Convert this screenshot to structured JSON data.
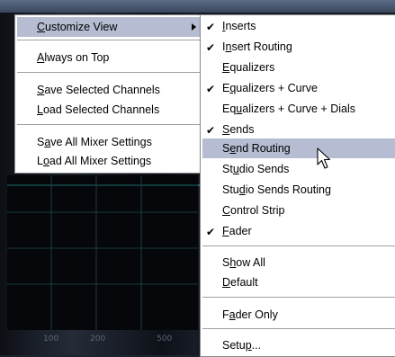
{
  "axis": {
    "labels": [
      "100",
      "200",
      "500"
    ]
  },
  "main_menu": {
    "items": [
      {
        "pre": "",
        "key": "C",
        "post": "ustomize View",
        "submenu": true,
        "highlighted": true
      },
      {
        "pre": "",
        "key": "A",
        "post": "lways on Top"
      },
      {
        "pre": "",
        "key": "S",
        "post": "ave Selected Channels"
      },
      {
        "pre": "",
        "key": "L",
        "post": "oad Selected Channels"
      },
      {
        "pre": "S",
        "key": "a",
        "post": "ve All Mixer Settings"
      },
      {
        "pre": "L",
        "key": "o",
        "post": "ad All Mixer Settings"
      }
    ]
  },
  "sub_menu": {
    "items": [
      {
        "pre": "",
        "key": "I",
        "post": "nserts",
        "checked": true
      },
      {
        "pre": "I",
        "key": "n",
        "post": "sert Routing",
        "checked": true
      },
      {
        "pre": "",
        "key": "E",
        "post": "qualizers",
        "checked": false
      },
      {
        "pre": "E",
        "key": "q",
        "post": "ualizers + Curve",
        "checked": true
      },
      {
        "pre": "Eq",
        "key": "u",
        "post": "alizers + Curve + Dials",
        "checked": false
      },
      {
        "pre": "",
        "key": "S",
        "post": "ends",
        "checked": true
      },
      {
        "pre": "S",
        "key": "e",
        "post": "nd Routing",
        "checked": false,
        "highlighted": true
      },
      {
        "pre": "St",
        "key": "u",
        "post": "dio Sends",
        "checked": false
      },
      {
        "pre": "Stu",
        "key": "d",
        "post": "io Sends Routing",
        "checked": false
      },
      {
        "pre": "",
        "key": "C",
        "post": "ontrol Strip",
        "checked": false
      },
      {
        "pre": "",
        "key": "F",
        "post": "ader",
        "checked": true
      },
      {
        "pre": "S",
        "key": "h",
        "post": "ow All",
        "checked": false
      },
      {
        "pre": "",
        "key": "D",
        "post": "efault",
        "checked": false
      },
      {
        "pre": "F",
        "key": "a",
        "post": "der Only",
        "checked": false
      },
      {
        "pre": "Setu",
        "key": "p",
        "post": "...",
        "checked": false
      }
    ]
  },
  "icons": {
    "checkmark": "✔",
    "submenu_arrow": "submenu-arrow-icon",
    "cursor": "mouse-pointer-icon"
  },
  "colors": {
    "highlight": "#b6bdd2",
    "menu_bg": "#ffffff",
    "eq_grid": "#1f6b6b"
  }
}
